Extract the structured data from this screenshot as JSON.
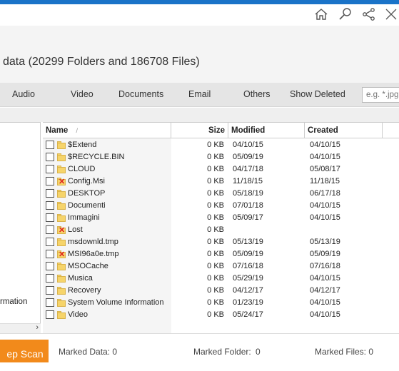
{
  "colors": {
    "accent": "#1a73c8",
    "scan_button": "#f28a1b"
  },
  "toolbar_icons": [
    "home-icon",
    "search-icon",
    "share-icon",
    "expand-icon"
  ],
  "header": {
    "title": "data (20299 Folders and 186708 Files)"
  },
  "filters": {
    "audio": "Audio",
    "video": "Video",
    "documents": "Documents",
    "email": "Email",
    "others": "Others",
    "show_deleted": "Show Deleted",
    "search_placeholder": "e.g. *.jpg"
  },
  "tree": {
    "visible_item": "rmation"
  },
  "table": {
    "headers": {
      "name": "Name",
      "size": "Size",
      "modified": "Modified",
      "created": "Created"
    },
    "rows": [
      {
        "name": "$Extend",
        "size": "0 KB",
        "modified": "04/10/15",
        "created": "04/10/15",
        "deleted": false
      },
      {
        "name": "$RECYCLE.BIN",
        "size": "0 KB",
        "modified": "05/09/19",
        "created": "04/10/15",
        "deleted": false
      },
      {
        "name": "CLOUD",
        "size": "0 KB",
        "modified": "04/17/18",
        "created": "05/08/17",
        "deleted": false
      },
      {
        "name": "Config.Msi",
        "size": "0 KB",
        "modified": "11/18/15",
        "created": "11/18/15",
        "deleted": true
      },
      {
        "name": "DESKTOP",
        "size": "0 KB",
        "modified": "05/18/19",
        "created": "06/17/18",
        "deleted": false
      },
      {
        "name": "Documenti",
        "size": "0 KB",
        "modified": "07/01/18",
        "created": "04/10/15",
        "deleted": false
      },
      {
        "name": "Immagini",
        "size": "0 KB",
        "modified": "05/09/17",
        "created": "04/10/15",
        "deleted": false
      },
      {
        "name": "Lost",
        "size": "0 KB",
        "modified": "",
        "created": "",
        "deleted": true
      },
      {
        "name": "msdownld.tmp",
        "size": "0 KB",
        "modified": "05/13/19",
        "created": "05/13/19",
        "deleted": false
      },
      {
        "name": "MSI96a0e.tmp",
        "size": "0 KB",
        "modified": "05/09/19",
        "created": "05/09/19",
        "deleted": true
      },
      {
        "name": "MSOCache",
        "size": "0 KB",
        "modified": "07/16/18",
        "created": "07/16/18",
        "deleted": false
      },
      {
        "name": "Musica",
        "size": "0 KB",
        "modified": "05/29/19",
        "created": "04/10/15",
        "deleted": false
      },
      {
        "name": "Recovery",
        "size": "0 KB",
        "modified": "04/12/17",
        "created": "04/12/17",
        "deleted": false
      },
      {
        "name": "System Volume Information",
        "size": "0 KB",
        "modified": "01/23/19",
        "created": "04/10/15",
        "deleted": false
      },
      {
        "name": "Video",
        "size": "0 KB",
        "modified": "05/24/17",
        "created": "04/10/15",
        "deleted": false
      }
    ]
  },
  "footer": {
    "scan_button": "ep Scan",
    "marked_data_label": "Marked Data:",
    "marked_data_value": "0",
    "marked_folder_label": "Marked Folder:",
    "marked_folder_value": "0",
    "marked_files_label": "Marked Files:",
    "marked_files_value": "0"
  }
}
